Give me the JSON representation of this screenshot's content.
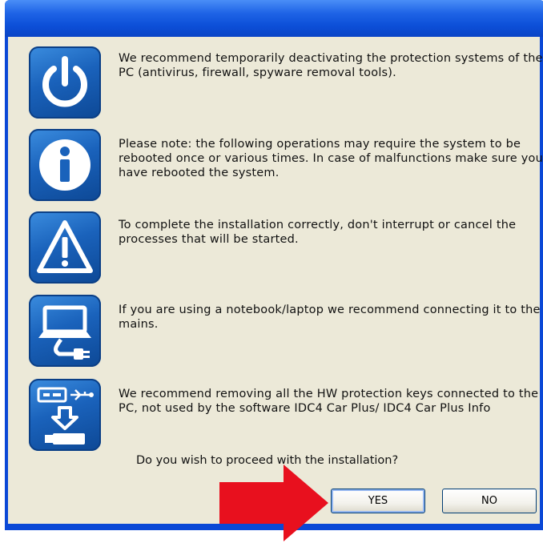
{
  "dialog": {
    "items": [
      {
        "icon": "power-icon",
        "text": "We recommend temporarily deactivating the protection systems of the PC (antivirus, firewall, spyware removal tools)."
      },
      {
        "icon": "info-icon",
        "text": "Please note: the following operations may require the system to be rebooted once or various times. In case of malfunctions make sure you have rebooted the system."
      },
      {
        "icon": "warning-icon",
        "text": "To complete the installation correctly, don't interrupt or cancel the processes that will be started."
      },
      {
        "icon": "laptop-plug-icon",
        "text": "If you are using a notebook/laptop we recommend connecting it to the mains."
      },
      {
        "icon": "usb-key-icon",
        "text": "We recommend removing all the HW protection keys connected to the PC, not used by the software IDC4 Car Plus/ IDC4 Car Plus Info"
      }
    ],
    "question": "Do you wish to proceed with the installation?",
    "yes_label": "YES",
    "no_label": "NO"
  },
  "colors": {
    "title_bar": "#0c4fd8",
    "dialog_background": "#ece9d8",
    "icon_blue": "#1a62bb",
    "arrow_red": "#e8101e"
  }
}
